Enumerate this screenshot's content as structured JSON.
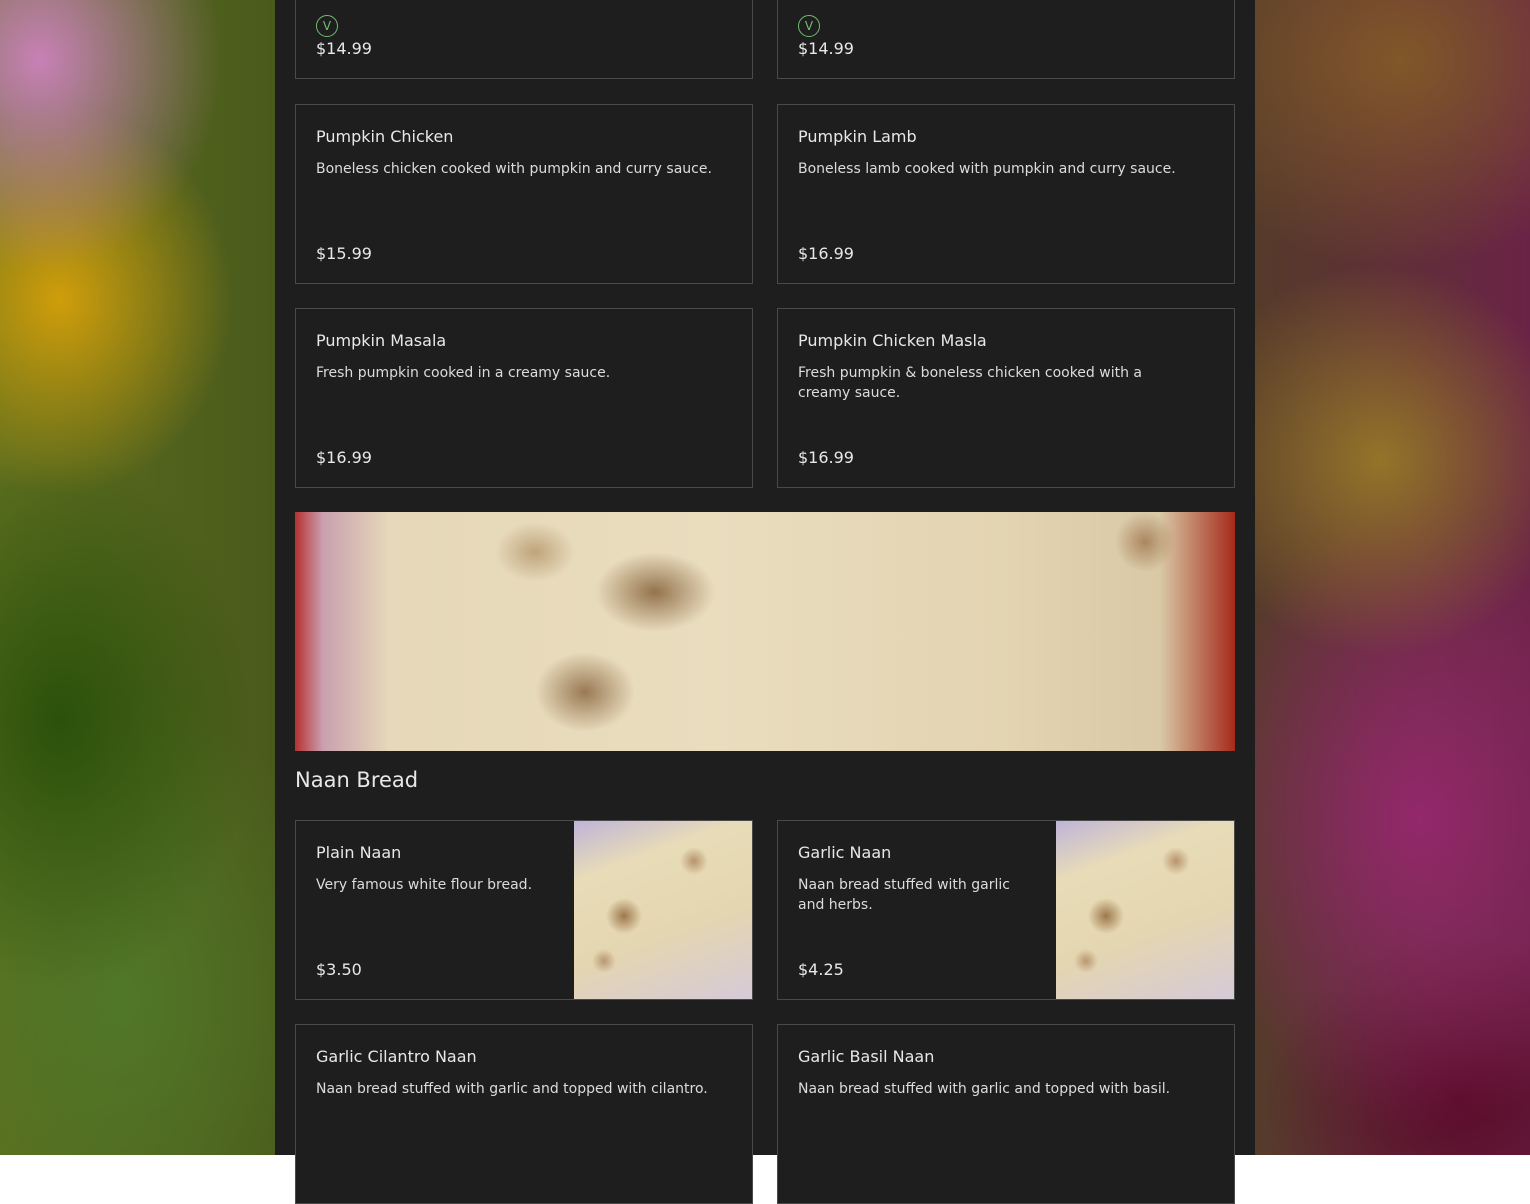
{
  "top_row": [
    {
      "price": "$14.99",
      "veg_icon": "V"
    },
    {
      "price": "$14.99",
      "veg_icon": "V"
    }
  ],
  "items_row1": [
    {
      "name": "Pumpkin Chicken",
      "description": "Boneless chicken cooked with pumpkin and curry sauce.",
      "price": "$15.99"
    },
    {
      "name": "Pumpkin Lamb",
      "description": "Boneless lamb cooked with pumpkin and curry sauce.",
      "price": "$16.99"
    }
  ],
  "items_row2": [
    {
      "name": "Pumpkin Masala",
      "description": "Fresh pumpkin cooked in a creamy sauce.",
      "price": "$16.99"
    },
    {
      "name": "Pumpkin Chicken Masla",
      "description": "Fresh pumpkin & boneless chicken cooked with a creamy sauce.",
      "price": "$16.99"
    }
  ],
  "naan_section": {
    "title": "Naan Bread",
    "row1": [
      {
        "name": "Plain Naan",
        "description": "Very famous white flour bread.",
        "price": "$3.50"
      },
      {
        "name": "Garlic Naan",
        "description": "Naan bread stuffed with garlic and herbs.",
        "price": "$4.25"
      }
    ],
    "row2": [
      {
        "name": "Garlic Cilantro Naan",
        "description": "Naan bread stuffed with garlic and topped with cilantro."
      },
      {
        "name": "Garlic Basil Naan",
        "description": "Naan bread stuffed with garlic and topped with basil."
      }
    ]
  }
}
